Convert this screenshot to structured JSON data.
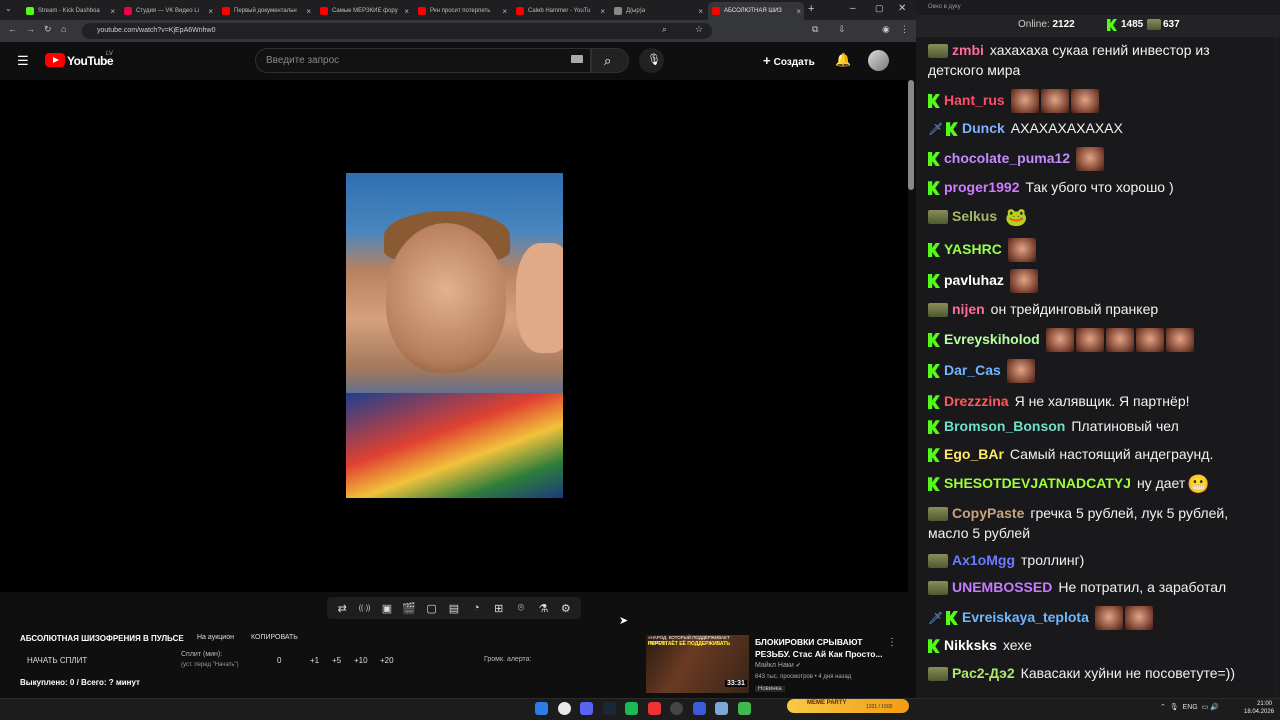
{
  "browser": {
    "tabs": [
      {
        "label": "Stream - Kick Dashboa",
        "color": "#53fc18"
      },
      {
        "label": "Студия — VK Видео Li",
        "color": "#e04"
      },
      {
        "label": "Первый документальн",
        "color": "#f00"
      },
      {
        "label": "Самые МЕРЗКИЕ фору",
        "color": "#f00"
      },
      {
        "label": "Ркн просит потерпеть",
        "color": "#f00"
      },
      {
        "label": "Caleb Hammer - YouTu",
        "color": "#f00"
      },
      {
        "label": "Д(ыр)а",
        "color": "#888"
      },
      {
        "label": "АБСОЛЮТНАЯ ШИЗ",
        "color": "#f00"
      }
    ],
    "url": "youtube.com/watch?v=KjEpA6Wnhw0"
  },
  "youtube": {
    "logo": "YouTube",
    "region": "LV",
    "search_placeholder": "Введите запрос",
    "create_label": "Создать"
  },
  "toolbar": {
    "icons": [
      "loop-icon",
      "broadcast-icon",
      "screen-icon",
      "clapper-icon",
      "frame-icon",
      "filmstrip-icon",
      "speed-icon",
      "pip-icon",
      "camera-icon",
      "lab-icon",
      "gear-icon"
    ],
    "glyphs": [
      "⇄",
      "((·))",
      "▣",
      "🎬",
      "▢",
      "▤",
      "◔",
      "⊞",
      "⌾",
      "⚗",
      "⚙"
    ]
  },
  "extension": {
    "title": "АБСОЛЮТНАЯ ШИЗОФРЕНИЯ В ПУЛЬСЕ",
    "auction": "На аукцион",
    "copy": "КОПИРОВАТЬ",
    "start_split": "НАЧАТЬ СПЛИТ",
    "split_label": "Сплит (мин):",
    "split_hint": "(уст. перед \"Начать\")",
    "split_value": "0",
    "inc1": "+1",
    "inc5": "+5",
    "inc10": "+10",
    "inc20": "+20",
    "alert_volume": "Громк. алерта:",
    "bought": "Выкуплено: 0 / Всего: ? минут"
  },
  "recommendation": {
    "thumb_text": "«НАРОД, КОТОРЫЙ ПОДДЕРЖИВАЕТ ВЛАСТЬ,",
    "thumb_text2": "ПЕРЕСТАЁТ ЕЁ ПОДДЕРЖИВАТЬ",
    "duration": "33:31",
    "title": "БЛОКИРОВКИ СРЫВАЮТ РЕЗЬБУ. Стас Ай Как Просто...",
    "channel": "Майкл Наки",
    "meta": "843 тыс. просмотров • 4 дня назад",
    "badge": "Новинка"
  },
  "chat": {
    "window_title": "Окно в дуку",
    "online_label": "Online:",
    "online_count": "2122",
    "k_count": "1485",
    "s_count": "637",
    "messages": [
      {
        "badges": [
          "s"
        ],
        "user": "zmbi",
        "color": "#ff6b9a",
        "text": "хахахаха сукаа гений инвестор из детского мира",
        "emotes": 0
      },
      {
        "badges": [
          "k"
        ],
        "user": "Hant_rus",
        "color": "#ff4d6d",
        "text": "",
        "emotes": 3
      },
      {
        "badges": [
          "sw",
          "k"
        ],
        "user": "Dunck",
        "color": "#7fb2ff",
        "text": "АХАХАХАХАХАХ",
        "emotes": 0
      },
      {
        "badges": [
          "k"
        ],
        "user": "chocolate_puma12",
        "color": "#c48bff",
        "text": "",
        "emotes": 1
      },
      {
        "badges": [
          "k"
        ],
        "user": "proger1992",
        "color": "#d07cff",
        "text": "Так убого что хорошо )",
        "emotes": 0
      },
      {
        "badges": [
          "s"
        ],
        "user": "Selkus",
        "color": "#a5b86a",
        "text": "",
        "emotes": 0,
        "emoji": "🐸"
      },
      {
        "badges": [
          "k"
        ],
        "user": "YASHRC",
        "color": "#9aff4d",
        "text": "",
        "emotes": 1
      },
      {
        "badges": [
          "k"
        ],
        "user": "pavluhaz",
        "color": "#ffffff",
        "text": "",
        "emotes": 1
      },
      {
        "badges": [
          "s"
        ],
        "user": "nijen",
        "color": "#ff6b9a",
        "text": "он трейдинговый пранкер",
        "emotes": 0
      },
      {
        "badges": [
          "k"
        ],
        "user": "Evreyskiholod",
        "color": "#b7ff9e",
        "text": "",
        "emotes": 5
      },
      {
        "badges": [
          "k"
        ],
        "user": "Dar_Cas",
        "color": "#6fb8ff",
        "text": "",
        "emotes": 1
      },
      {
        "badges": [
          "k"
        ],
        "user": "Drezzzina",
        "color": "#ff5a5a",
        "text": "Я не халявщик. Я партнёр!",
        "emotes": 0
      },
      {
        "badges": [
          "k"
        ],
        "user": "Bromson_Bonson",
        "color": "#6ee0c9",
        "text": "Платиновый чел",
        "emotes": 0
      },
      {
        "badges": [
          "k"
        ],
        "user": "Ego_BAr",
        "color": "#ffe86b",
        "text": "Самый настоящий андеграунд.",
        "emotes": 0
      },
      {
        "badges": [
          "k"
        ],
        "user": "SHESOTDEVJATNADCATYJ",
        "color": "#9dff3b",
        "text": "ну дает",
        "emotes": 0,
        "emoji": "😬"
      },
      {
        "badges": [
          "s"
        ],
        "user": "CopyPaste",
        "color": "#c9a27e",
        "text": "гречка 5 рублей, лук 5 рублей, масло 5 рублей",
        "emotes": 0
      },
      {
        "badges": [
          "s"
        ],
        "user": "Ax1oMgg",
        "color": "#6b7cff",
        "text": "троллинг)",
        "emotes": 0
      },
      {
        "badges": [
          "s"
        ],
        "user": "UNEMBOSSED",
        "color": "#c57dff",
        "text": "Не потратил, а заработал",
        "emotes": 0
      },
      {
        "badges": [
          "sw",
          "k"
        ],
        "user": "Evreiskaya_teplota",
        "color": "#6fb8ff",
        "text": "",
        "emotes": 2
      },
      {
        "badges": [
          "k"
        ],
        "user": "Nikksks",
        "color": "#ffffff",
        "text": "хехе",
        "emotes": 0
      },
      {
        "badges": [
          "s"
        ],
        "user": "Рас2-Дэ2",
        "color": "#aee86b",
        "text": "Кавасаки хуйни не посоветуте=))",
        "emotes": 0
      }
    ]
  },
  "taskbar": {
    "meme_label": "MEME PARTY",
    "meme_value": "1331 / 1500",
    "lang": "ENG",
    "time": "21:00",
    "date": "18.04.2026"
  }
}
